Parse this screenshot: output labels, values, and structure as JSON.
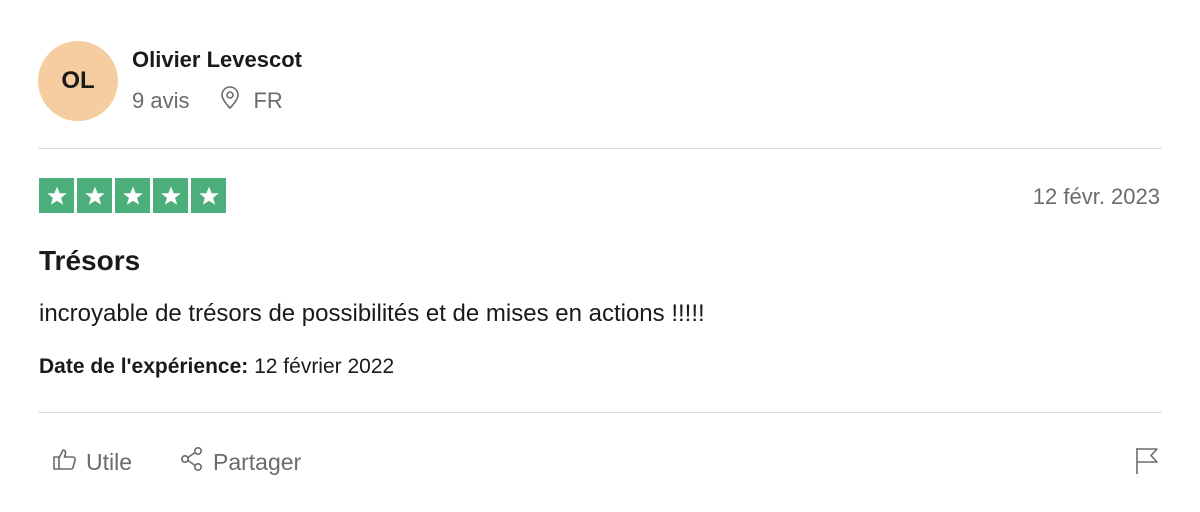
{
  "author": {
    "initials": "OL",
    "name": "Olivier Levescot",
    "reviews_count": "9 avis",
    "country": "FR",
    "avatar_color": "#f6cda0"
  },
  "review": {
    "rating": 5,
    "star_color": "#4cae7b",
    "date": "12 févr. 2023",
    "title": "Trésors",
    "body": "incroyable de trésors de possibilités et de mises en actions !!!!!",
    "experience_label": "Date de l'expérience:",
    "experience_date": "12 février 2022"
  },
  "actions": {
    "useful_label": "Utile",
    "share_label": "Partager"
  },
  "icons": {
    "location": "location-pin-icon",
    "useful": "thumbs-up-icon",
    "share": "share-icon",
    "report": "flag-icon",
    "star": "star-icon"
  }
}
